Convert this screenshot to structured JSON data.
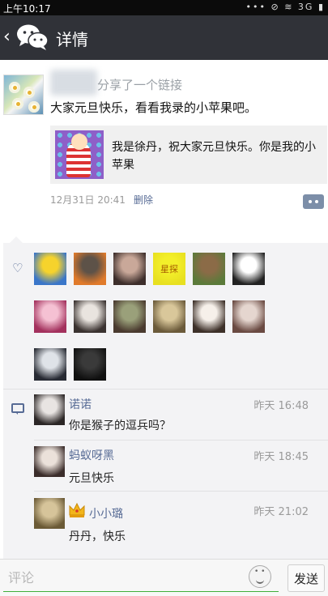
{
  "status_bar": {
    "time": "上午10:17",
    "icons_text": "••• ⊘ ≋ 3G ▮"
  },
  "header": {
    "title": "详情",
    "back_icon": "chevron-left-icon",
    "logo_icon": "wechat-logo-icon"
  },
  "post": {
    "share_text": "分享了一个链接",
    "text": "大家元旦快乐，看看我录的小苹果吧。",
    "link_text": "我是徐丹，祝大家元旦快乐。你是我的小苹果",
    "time": "12月31日 20:41",
    "delete_label": "删除"
  },
  "likes": {
    "icon": "heart-outline-icon",
    "avatars": [
      {
        "name": "liker-1",
        "colors": [
          "#f6d32c",
          "#3a76c9"
        ],
        "label": ""
      },
      {
        "name": "liker-2",
        "colors": [
          "#5d5248",
          "#e07a2b"
        ],
        "label": ""
      },
      {
        "name": "liker-3",
        "colors": [
          "#c9a899",
          "#3d2e2b"
        ],
        "label": ""
      },
      {
        "name": "liker-4",
        "colors": [
          "#f3ef2a",
          "#e8e020"
        ],
        "label": "星探"
      },
      {
        "name": "liker-5",
        "colors": [
          "#8b6b47",
          "#5b7a3a"
        ],
        "label": ""
      },
      {
        "name": "liker-6",
        "colors": [
          "#ffffff",
          "#222222"
        ],
        "label": ""
      },
      {
        "name": "liker-7",
        "colors": [
          "#f5c1d3",
          "#a3315d"
        ],
        "label": ""
      },
      {
        "name": "liker-8",
        "colors": [
          "#e9e4df",
          "#3a3230"
        ],
        "label": ""
      },
      {
        "name": "liker-9",
        "colors": [
          "#9aa07a",
          "#4a3a2f"
        ],
        "label": ""
      },
      {
        "name": "liker-10",
        "colors": [
          "#d9c79a",
          "#6b5a3a"
        ],
        "label": ""
      },
      {
        "name": "liker-11",
        "colors": [
          "#f6f0ea",
          "#3d3029"
        ],
        "label": ""
      },
      {
        "name": "liker-12",
        "colors": [
          "#e5d6cf",
          "#6a4a42"
        ],
        "label": ""
      },
      {
        "name": "liker-13",
        "colors": [
          "#dfe3e8",
          "#272a33"
        ],
        "label": ""
      },
      {
        "name": "liker-14",
        "colors": [
          "#3a3a3a",
          "#101010"
        ],
        "label": ""
      }
    ]
  },
  "comments": {
    "icon": "comment-icon",
    "items": [
      {
        "name": "诺诺",
        "time": "昨天 16:48",
        "text": "你是猴子的逗兵吗？",
        "colors": [
          "#e8e4e2",
          "#2b2626"
        ]
      },
      {
        "name": "蚂蚁呀黑",
        "time": "昨天 18:45",
        "text": "元旦快乐",
        "colors": [
          "#ebe1da",
          "#3a2c2a"
        ]
      },
      {
        "name": "小小璐",
        "time": "昨天 21:02",
        "text": "丹丹，快乐",
        "colors": [
          "#d6c49a",
          "#6b5a36"
        ]
      }
    ]
  },
  "input_bar": {
    "placeholder": "评论",
    "send_label": "发送",
    "emoji_icon": "smiley-icon"
  },
  "colors": {
    "link_blue": "#576b95",
    "titlebar": "#303238",
    "panel": "#f3f3f5",
    "input_accent": "#3fae3b"
  }
}
